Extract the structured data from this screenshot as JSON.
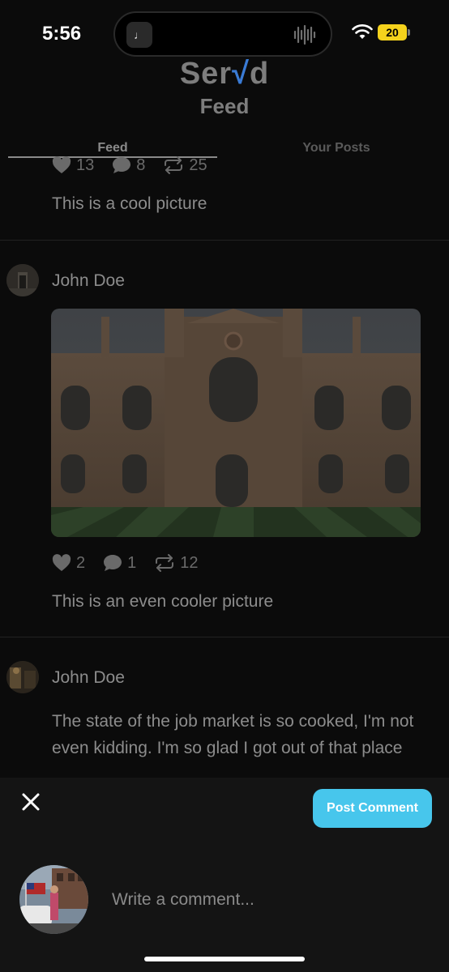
{
  "status_bar": {
    "time": "5:56",
    "battery": "20"
  },
  "header": {
    "logo_prefix": "Ser",
    "logo_accent": "√",
    "logo_suffix": "d",
    "title": "Feed"
  },
  "tabs": [
    {
      "label": "Feed",
      "active": true
    },
    {
      "label": "Your Posts",
      "active": false
    }
  ],
  "posts": [
    {
      "likes": "13",
      "comments": "8",
      "reposts": "25",
      "caption": "This is a cool picture"
    },
    {
      "author": "John Doe",
      "likes": "2",
      "comments": "1",
      "reposts": "12",
      "caption": "This is an even cooler picture"
    },
    {
      "author": "John Doe",
      "text": "The state of the job market is so cooked, I'm not even kidding. I'm so glad I got out of that place"
    }
  ],
  "comment_sheet": {
    "post_button": "Post Comment",
    "placeholder": "Write a comment..."
  },
  "colors": {
    "accent": "#47c6ec",
    "logo_accent": "#3a7bd5",
    "background": "#0b0b0b"
  }
}
